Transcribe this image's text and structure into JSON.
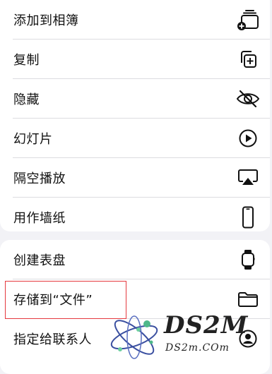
{
  "menu": {
    "group1": [
      {
        "label": "添加到相簿",
        "icon": "add-to-album-icon"
      },
      {
        "label": "复制",
        "icon": "duplicate-icon"
      },
      {
        "label": "隐藏",
        "icon": "hide-eye-slash-icon"
      },
      {
        "label": "幻灯片",
        "icon": "play-circle-icon"
      },
      {
        "label": "隔空播放",
        "icon": "airplay-icon"
      },
      {
        "label": "用作墙纸",
        "icon": "iphone-icon"
      }
    ],
    "group2": [
      {
        "label": "创建表盘",
        "icon": "apple-watch-icon"
      },
      {
        "label": "存储到“文件”",
        "icon": "folder-icon"
      },
      {
        "label": "指定给联系人",
        "icon": "contact-icon"
      }
    ]
  },
  "highlight": {
    "color": "#e5393f"
  },
  "watermark": {
    "brand": "DS2M",
    "url": "DS2m.COm"
  },
  "colors": {
    "background": "#f2f2f6",
    "card": "#ffffff",
    "text": "#111111",
    "separator": "#dcdce0"
  }
}
